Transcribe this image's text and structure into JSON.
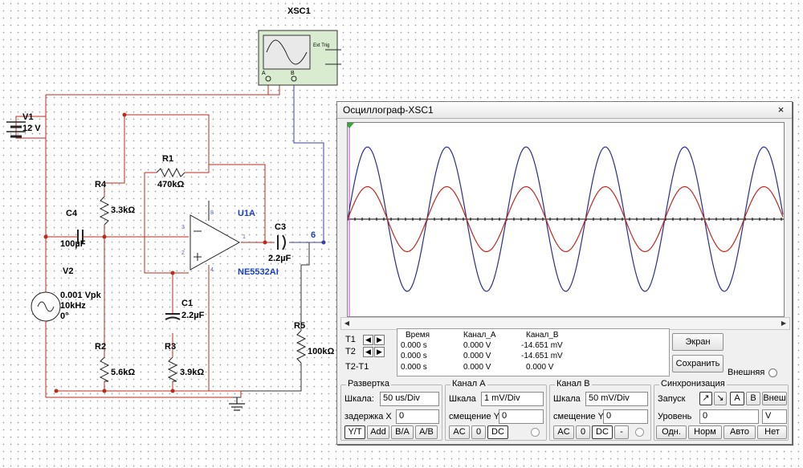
{
  "schematic": {
    "scope_ref": "XSC1",
    "scope_ports": {
      "a": "A",
      "b": "B",
      "ext": "Ext Trig"
    },
    "v1": {
      "ref": "V1",
      "value": "12 V"
    },
    "v2": {
      "ref": "V2",
      "value1": "0.001 Vpk",
      "value2": "10kHz",
      "value3": "0°"
    },
    "r1": {
      "ref": "R1",
      "value": "470kΩ"
    },
    "r2": {
      "ref": "R2",
      "value": "5.6kΩ"
    },
    "r3": {
      "ref": "R3",
      "value": "3.9kΩ"
    },
    "r4": {
      "ref": "R4",
      "value": "3.3kΩ"
    },
    "r5": {
      "ref": "R5",
      "value": "100kΩ"
    },
    "c1": {
      "ref": "C1",
      "value": "2.2µF"
    },
    "c3": {
      "ref": "C3",
      "value": "2.2µF"
    },
    "c4": {
      "ref": "C4",
      "value": "100µF"
    },
    "u1": {
      "ref": "U1A",
      "model": "NE5532AI"
    },
    "net": "6",
    "pins": {
      "p3": "3",
      "p2": "2",
      "p8": "8",
      "p4": "4",
      "p1": "1"
    }
  },
  "scope_window": {
    "title": "Осциллограф-XSC1",
    "close": "×",
    "readout": {
      "headers": [
        "Время",
        "Канал_A",
        "Канал_B"
      ],
      "rows": [
        {
          "label": "T1",
          "time": "0.000 s",
          "a": "0.000 V",
          "b": "-14.651 mV"
        },
        {
          "label": "T2",
          "time": "0.000 s",
          "a": "0.000 V",
          "b": "-14.651 mV"
        },
        {
          "label": "T2-T1",
          "time": "0.000 s",
          "a": "0.000 V",
          "b": "0.000 V"
        }
      ]
    },
    "buttons": {
      "screen": "Экран",
      "save": "Сохранить",
      "external": "Внешняя"
    },
    "timebase": {
      "title": "Развертка",
      "scale_label": "Шкала:",
      "scale_value": "50 us/Div",
      "delay_label": "задержка X",
      "delay_value": "0",
      "modes": [
        "Y/T",
        "Add",
        "B/A",
        "A/B"
      ]
    },
    "channel_a": {
      "title": "Канал A",
      "scale_label": "Шкала",
      "scale_value": "1 mV/Div",
      "offset_label": "смещение Y",
      "offset_value": "0",
      "coupling": [
        "AC",
        "0",
        "DC"
      ]
    },
    "channel_b": {
      "title": "Канал B",
      "scale_label": "Шкала",
      "scale_value": "50 mV/Div",
      "offset_label": "смещение Y",
      "offset_value": "0",
      "coupling": [
        "AC",
        "0",
        "DC",
        "-"
      ]
    },
    "trigger": {
      "title": "Синхронизация",
      "edge_label": "Запуск",
      "sources": [
        "A",
        "B",
        "Внеш"
      ],
      "level_label": "Уровень",
      "level_value": "0",
      "level_unit": "V",
      "modes": [
        "Одн.",
        "Норм",
        "Авто",
        "Нет"
      ]
    },
    "colors": {
      "channel_a": "#c0281e",
      "channel_b": "#2b2e8c",
      "axis": "#000000"
    }
  },
  "chart_data": {
    "type": "line",
    "grid": false,
    "series": [
      {
        "color": "#2b2e8c",
        "amplitude_div": 1.0,
        "cycles": 5.5
      },
      {
        "color": "#c0281e",
        "amplitude_div": 0.45,
        "cycles": 5.5
      }
    ]
  }
}
